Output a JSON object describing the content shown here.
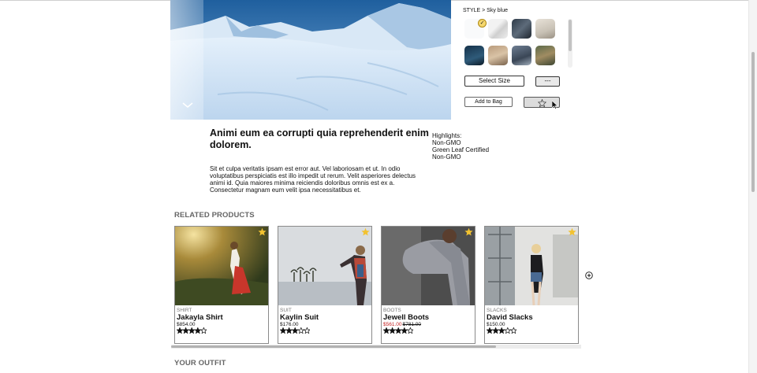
{
  "product": {
    "style_prefix": "STYLE > ",
    "style_name": "Sky blue",
    "title": "Animi eum ea corrupti quia reprehenderit enim dolorem.",
    "description": "Sit et culpa veritatis ipsam est error aut. Vel laboriosam et ut. In odio voluptatibus perspiciatis est illo impedit ut rerum. Velit asperiores delectus animi id. Quia maiores minima reiciendis doloribus omnis est ex a. Consectetur magnam eum velit ipsa necessitatibus et.",
    "highlights_label": "Highlights:",
    "highlights": [
      "Non-GMO",
      "Green Leaf Certified",
      "Non-GMO"
    ]
  },
  "controls": {
    "select_size": "Select Size",
    "quantity": "---",
    "add_to_bag": "Add to Bag"
  },
  "related": {
    "heading": "RELATED PRODUCTS",
    "items": [
      {
        "category": "SHIRT",
        "name": "Jakayla Shirt",
        "price": "$854.00",
        "sale_price": "",
        "rating": 4
      },
      {
        "category": "SUIT",
        "name": "Kaylin Suit",
        "price": "$176.00",
        "sale_price": "",
        "rating": 3
      },
      {
        "category": "BOOTS",
        "name": "Jewell Boots",
        "price": "$781.00",
        "sale_price": "$561.00",
        "rating": 4
      },
      {
        "category": "SLACKS",
        "name": "David Slacks",
        "price": "$150.00",
        "sale_price": "",
        "rating": 3
      }
    ]
  },
  "outfit": {
    "heading": "YOUR OUTFIT"
  },
  "colors": {
    "star_gold": "#f2c230",
    "sale_red": "#c41e1e",
    "heading_gray": "#666666"
  }
}
